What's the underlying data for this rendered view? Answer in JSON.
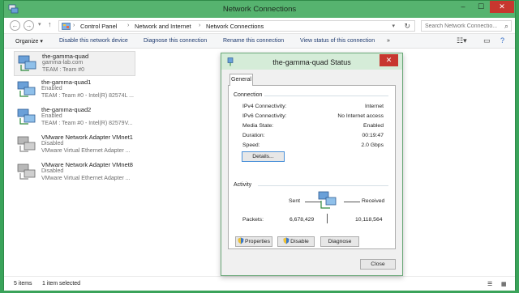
{
  "window": {
    "title": "Network Connections",
    "controls": {
      "minimize": "–",
      "maximize": "☐",
      "close": "✕"
    },
    "colors": {
      "titlebar": "#56b36f",
      "accent": "#c7372f",
      "link": "#1e3a6f"
    }
  },
  "address": {
    "back": "←",
    "forward": "→",
    "up": "↑",
    "breadcrumb": [
      "Control Panel",
      "Network and Internet",
      "Network Connections"
    ],
    "separator": "›",
    "refresh": "↻",
    "search_placeholder": "Search Network Connectio..."
  },
  "toolbar": {
    "organize": "Organize ▾",
    "items": [
      "Disable this network device",
      "Diagnose this connection",
      "Rename this connection",
      "View status of this connection"
    ],
    "more": "»",
    "view_icon": "change-view-icon",
    "pane_icon": "preview-pane-icon",
    "help_icon": "help-icon"
  },
  "connections": [
    {
      "name": "the-gamma-quad",
      "line2": "gamma-lab.com",
      "line3": "TEAM : Team #0",
      "icon": "network-adapter-icon",
      "status": "enabled",
      "selected": true
    },
    {
      "name": "the-gamma-quad1",
      "line2": "Enabled",
      "line3": "TEAM : Team #0 - Intel(R) 82574L ...",
      "icon": "network-adapter-icon",
      "status": "enabled",
      "selected": false
    },
    {
      "name": "the-gamma-quad2",
      "line2": "Enabled",
      "line3": "TEAM : Team #0 - Intel(R) 82579V...",
      "icon": "network-adapter-icon",
      "status": "enabled",
      "selected": false
    },
    {
      "name": "VMware Network Adapter VMnet1",
      "line2": "Disabled",
      "line3": "VMware Virtual Ethernet Adapter ...",
      "icon": "network-adapter-icon",
      "status": "disabled",
      "selected": false
    },
    {
      "name": "VMware Network Adapter VMnet8",
      "line2": "Disabled",
      "line3": "VMware Virtual Ethernet Adapter ...",
      "icon": "network-adapter-icon",
      "status": "disabled",
      "selected": false
    }
  ],
  "statusbar": {
    "count": "5 items",
    "selection": "1 item selected"
  },
  "dialog": {
    "title": "the-gamma-quad Status",
    "close": "✕",
    "tab": "General",
    "connection": {
      "heading": "Connection",
      "rows": [
        {
          "label": "IPv4 Connectivity:",
          "value": "Internet"
        },
        {
          "label": "IPv6 Connectivity:",
          "value": "No Internet access"
        },
        {
          "label": "Media State:",
          "value": "Enabled"
        },
        {
          "label": "Duration:",
          "value": "00:19:47"
        },
        {
          "label": "Speed:",
          "value": "2.0 Gbps"
        }
      ],
      "details_button": "Details..."
    },
    "activity": {
      "heading": "Activity",
      "sent_label": "Sent",
      "received_label": "Received",
      "packets_label": "Packets:",
      "packets_sent": "6,678,429",
      "packets_received": "10,118,564"
    },
    "buttons": {
      "properties": "Properties",
      "disable": "Disable",
      "diagnose": "Diagnose",
      "close": "Close"
    }
  }
}
